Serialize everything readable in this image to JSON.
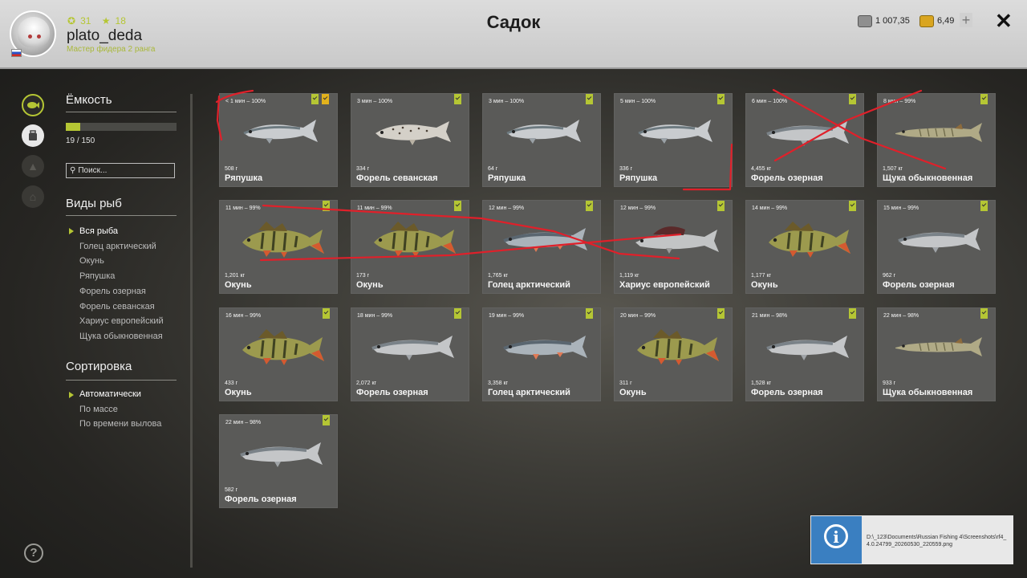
{
  "player": {
    "coins": "31",
    "stars": "18",
    "name": "plato_deda",
    "rank": "Мастер фидера 2 ранга"
  },
  "screen_title": "Садок",
  "currency": {
    "silver": "1 007,35",
    "gold": "6,49"
  },
  "icons": [
    "fish-keepnet-icon",
    "bucket-icon",
    "fire-icon",
    "home-icon"
  ],
  "capacity": {
    "heading": "Ёмкость",
    "value_text": "19 / 150",
    "fill_fraction": 0.127
  },
  "search": {
    "placeholder": "Поиск..."
  },
  "species": {
    "heading": "Виды рыб",
    "items": [
      "Вся рыба",
      "Голец арктический",
      "Окунь",
      "Ряпушка",
      "Форель озерная",
      "Форель севанская",
      "Хариус европейский",
      "Щука обыкновенная"
    ]
  },
  "sorting": {
    "heading": "Сортировка",
    "items": [
      "Автоматически",
      "По массе",
      "По времени вылова"
    ]
  },
  "fish": [
    {
      "time": "< 1 мин – 100%",
      "weight": "508 г",
      "name": "Ряпушка",
      "kind": "vendace",
      "gold": true
    },
    {
      "time": "3 мин – 100%",
      "weight": "334 г",
      "name": "Форель севанская",
      "kind": "spotted",
      "gold": false
    },
    {
      "time": "3 мин – 100%",
      "weight": "64 г",
      "name": "Ряпушка",
      "kind": "vendace",
      "gold": false
    },
    {
      "time": "5 мин – 100%",
      "weight": "336 г",
      "name": "Ряпушка",
      "kind": "vendace",
      "gold": false
    },
    {
      "time": "6 мин – 100%",
      "weight": "4,455 кг",
      "name": "Форель озерная",
      "kind": "trout",
      "gold": false
    },
    {
      "time": "8 мин – 99%",
      "weight": "1,507 кг",
      "name": "Щука обыкновенная",
      "kind": "pike",
      "gold": false
    },
    {
      "time": "11 мин – 99%",
      "weight": "1,201 кг",
      "name": "Окунь",
      "kind": "perch",
      "gold": false
    },
    {
      "time": "11 мин – 99%",
      "weight": "173 г",
      "name": "Окунь",
      "kind": "perch",
      "gold": false
    },
    {
      "time": "12 мин – 99%",
      "weight": "1,765 кг",
      "name": "Голец арктический",
      "kind": "char",
      "gold": false
    },
    {
      "time": "12 мин – 99%",
      "weight": "1,119 кг",
      "name": "Хариус европейский",
      "kind": "grayling",
      "gold": false
    },
    {
      "time": "14 мин – 99%",
      "weight": "1,177 кг",
      "name": "Окунь",
      "kind": "perch",
      "gold": false
    },
    {
      "time": "15 мин – 99%",
      "weight": "962 г",
      "name": "Форель озерная",
      "kind": "trout",
      "gold": false
    },
    {
      "time": "16 мин – 99%",
      "weight": "433 г",
      "name": "Окунь",
      "kind": "perch",
      "gold": false
    },
    {
      "time": "18 мин – 99%",
      "weight": "2,072 кг",
      "name": "Форель озерная",
      "kind": "trout",
      "gold": false
    },
    {
      "time": "19 мин – 99%",
      "weight": "3,358 кг",
      "name": "Голец арктический",
      "kind": "char",
      "gold": false
    },
    {
      "time": "20 мин – 99%",
      "weight": "311 г",
      "name": "Окунь",
      "kind": "perch",
      "gold": false
    },
    {
      "time": "21 мин – 98%",
      "weight": "1,528 кг",
      "name": "Форель озерная",
      "kind": "trout",
      "gold": false
    },
    {
      "time": "22 мин – 98%",
      "weight": "933 г",
      "name": "Щука обыкновенная",
      "kind": "pike",
      "gold": false
    },
    {
      "time": "22 мин – 98%",
      "weight": "582 г",
      "name": "Форель озерная",
      "kind": "trout",
      "gold": false
    }
  ],
  "help": {
    "label": "?"
  },
  "notification": {
    "path": "D:\\_123\\Documents\\Russian Fishing 4\\Screenshots\\rf4_4.0.24799_20260530_220559.png"
  },
  "colors": {
    "accent": "#b5c634",
    "annotation": "#e0202a",
    "card_bg": "#5a5a58",
    "toast_blue": "#3a7fc1"
  }
}
